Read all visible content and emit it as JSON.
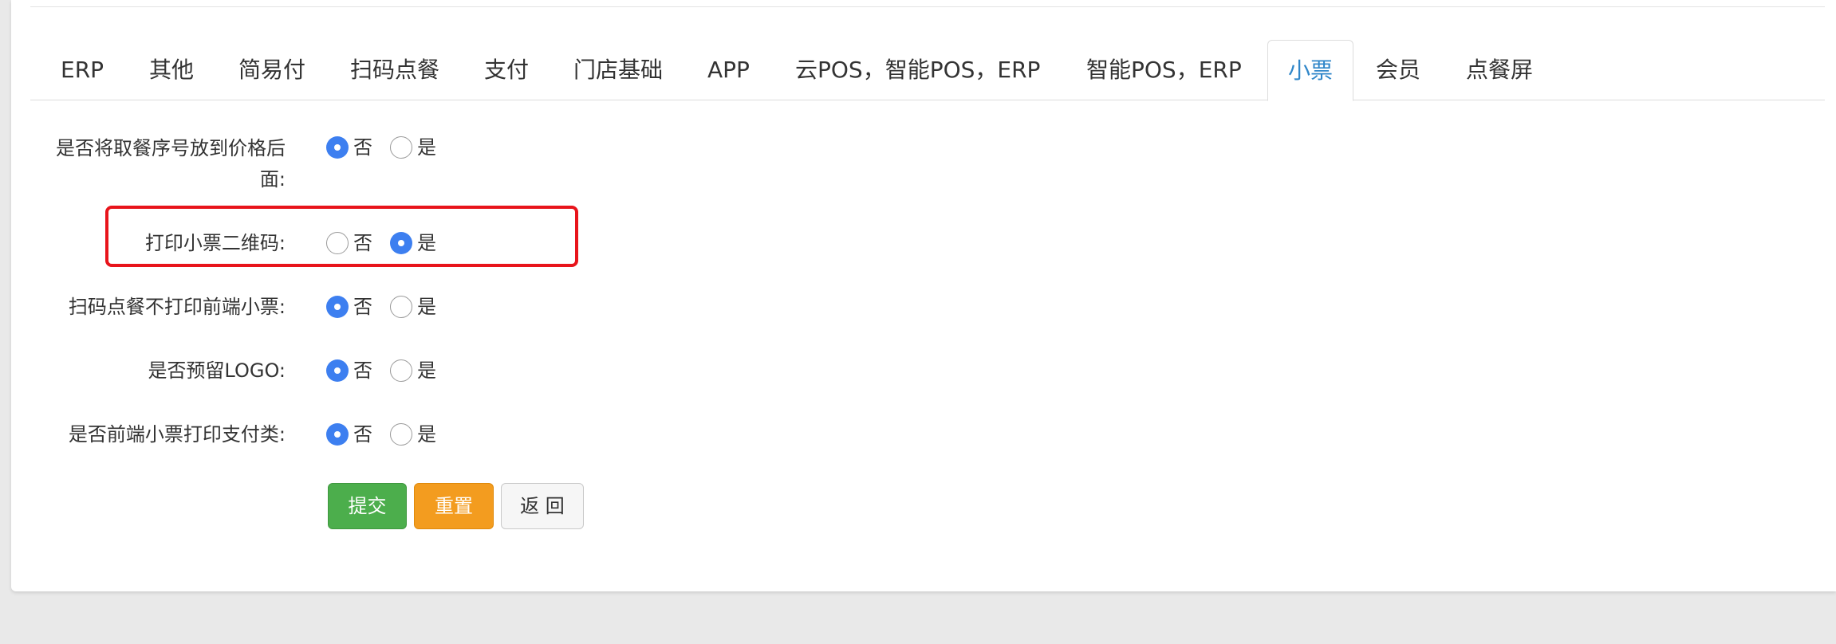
{
  "tabs": [
    {
      "label": "ERP"
    },
    {
      "label": "其他"
    },
    {
      "label": "简易付"
    },
    {
      "label": "扫码点餐"
    },
    {
      "label": "支付"
    },
    {
      "label": "门店基础"
    },
    {
      "label": "APP"
    },
    {
      "label": "云POS，智能POS，ERP"
    },
    {
      "label": "智能POS，ERP"
    },
    {
      "label": "小票"
    },
    {
      "label": "会员"
    },
    {
      "label": "点餐屏"
    }
  ],
  "active_tab": "小票",
  "form": {
    "option_no": "否",
    "option_yes": "是",
    "rows": [
      {
        "label_line1": "是否将取餐序号放到价格后",
        "label_line2": "面:",
        "selected": "否"
      },
      {
        "label": "打印小票二维码:",
        "selected": "是"
      },
      {
        "label": "扫码点餐不打印前端小票:",
        "selected": "否"
      },
      {
        "label": "是否预留LOGO:",
        "selected": "否"
      },
      {
        "label": "是否前端小票打印支付类:",
        "selected": "否"
      }
    ]
  },
  "buttons": {
    "submit": "提交",
    "reset": "重置",
    "back": "返 回"
  },
  "colors": {
    "accent_blue": "#3d7ff0",
    "tab_active_text": "#2f86c9",
    "highlight_red": "#e8141b",
    "submit_green": "#4cae4c",
    "reset_orange": "#f39c1f"
  }
}
